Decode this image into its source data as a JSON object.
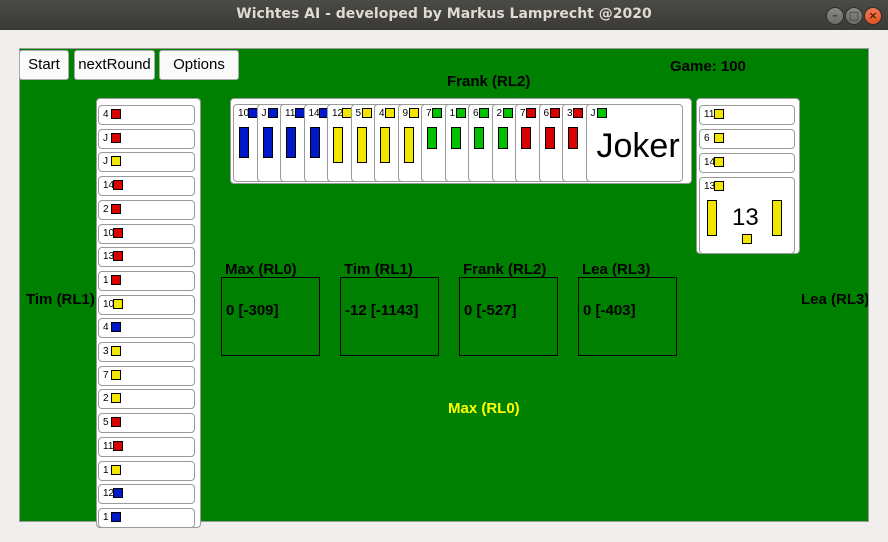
{
  "window": {
    "title": "Wichtes AI - developed by Markus Lamprecht @2020"
  },
  "toolbar": {
    "start_label": "Start",
    "next_round_label": "nextRound",
    "options_label": "Options"
  },
  "game_label": "Game: 100",
  "players": {
    "top": "Frank (RL2)",
    "left": "Tim (RL1)",
    "right": "Lea (RL3)",
    "bottom": "Max (RL0)"
  },
  "scores": [
    {
      "name": "Max (RL0)",
      "value": "0 [-309]"
    },
    {
      "name": "Tim (RL1)",
      "value": "-12 [-1143]"
    },
    {
      "name": "Frank (RL2)",
      "value": "0 [-527]"
    },
    {
      "name": "Lea (RL3)",
      "value": "0 [-403]"
    }
  ],
  "left_hand": [
    {
      "rank": "4",
      "color": "red"
    },
    {
      "rank": "J",
      "color": "red"
    },
    {
      "rank": "J",
      "color": "yellow"
    },
    {
      "rank": "14",
      "color": "red"
    },
    {
      "rank": "2",
      "color": "red"
    },
    {
      "rank": "10",
      "color": "red"
    },
    {
      "rank": "13",
      "color": "red"
    },
    {
      "rank": "1",
      "color": "red"
    },
    {
      "rank": "10",
      "color": "yellow"
    },
    {
      "rank": "4",
      "color": "blue"
    },
    {
      "rank": "3",
      "color": "yellow"
    },
    {
      "rank": "7",
      "color": "yellow"
    },
    {
      "rank": "2",
      "color": "yellow"
    },
    {
      "rank": "5",
      "color": "red"
    },
    {
      "rank": "11",
      "color": "red"
    },
    {
      "rank": "1",
      "color": "yellow"
    },
    {
      "rank": "12",
      "color": "blue"
    },
    {
      "rank": "1",
      "color": "blue"
    }
  ],
  "top_hand": [
    {
      "rank": "10",
      "color": "blue"
    },
    {
      "rank": "J",
      "color": "blue"
    },
    {
      "rank": "11",
      "color": "blue"
    },
    {
      "rank": "14",
      "color": "blue"
    },
    {
      "rank": "12",
      "color": "yellow"
    },
    {
      "rank": "5",
      "color": "yellow"
    },
    {
      "rank": "4",
      "color": "yellow"
    },
    {
      "rank": "9",
      "color": "yellow"
    },
    {
      "rank": "7",
      "color": "green"
    },
    {
      "rank": "1",
      "color": "green"
    },
    {
      "rank": "6",
      "color": "green"
    },
    {
      "rank": "2",
      "color": "green"
    },
    {
      "rank": "7",
      "color": "red"
    },
    {
      "rank": "6",
      "color": "red"
    },
    {
      "rank": "3",
      "color": "red"
    },
    {
      "rank": "J",
      "color": "green",
      "center": "Joker"
    }
  ],
  "right_hand": [
    {
      "rank": "11",
      "color": "yellow"
    },
    {
      "rank": "6",
      "color": "yellow"
    },
    {
      "rank": "14",
      "color": "yellow"
    },
    {
      "rank": "13",
      "color": "yellow",
      "center": "13"
    }
  ],
  "colors": {
    "table": "#008000",
    "red": "#d80000",
    "yellow": "#f2e600",
    "blue": "#0018c8",
    "green": "#00c000",
    "highlight": "#ffff00"
  }
}
